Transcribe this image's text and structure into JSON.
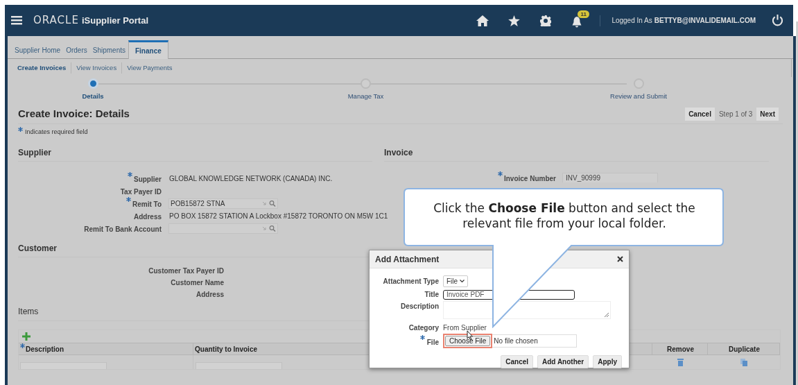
{
  "header": {
    "logo": "ORACLE",
    "app_title": "iSupplier Portal",
    "notification_count": "11",
    "logged_in_label": "Logged In As",
    "user": "BETTYB@INVALIDEMAIL.COM"
  },
  "tabs": [
    {
      "label": "Supplier Home",
      "selected": false
    },
    {
      "label": "Orders",
      "selected": false
    },
    {
      "label": "Shipments",
      "selected": false
    },
    {
      "label": "Finance",
      "selected": true
    }
  ],
  "subtabs": [
    {
      "label": "Create Invoices",
      "selected": true
    },
    {
      "label": "View Invoices",
      "selected": false
    },
    {
      "label": "View Payments",
      "selected": false
    }
  ],
  "train": [
    {
      "label": "Details",
      "selected": true
    },
    {
      "label": "Manage Tax",
      "selected": false
    },
    {
      "label": "Review and Submit",
      "selected": false
    }
  ],
  "page_title": "Create Invoice: Details",
  "actions": {
    "cancel": "Cancel",
    "step": "Step 1 of 3",
    "next": "Next"
  },
  "required_note": "Indicates required field",
  "supplier": {
    "heading": "Supplier",
    "fields": [
      {
        "label": "Supplier",
        "kind": "text",
        "value": "GLOBAL KNOWLEDGE NETWORK (CANADA) INC.",
        "required": true
      },
      {
        "label": "Tax Payer ID",
        "kind": "text",
        "required": false
      },
      {
        "label": "Remit To",
        "kind": "lov",
        "value": "POB15872 STNA",
        "required": true
      },
      {
        "label": "Address",
        "kind": "text",
        "value": "PO BOX 15872 STATION A Lockbox #15872 TORONTO ON M5W 1C1",
        "required": false
      },
      {
        "label": "Remit To Bank Account",
        "kind": "lov",
        "required": false
      }
    ]
  },
  "invoice": {
    "heading": "Invoice",
    "fields": [
      {
        "label": "Invoice Number",
        "value": "INV_90999",
        "required": true
      }
    ]
  },
  "customer": {
    "heading": "Customer",
    "fields": [
      {
        "label": "Customer Tax Payer ID"
      },
      {
        "label": "Customer Name"
      },
      {
        "label": "Address"
      }
    ]
  },
  "items": {
    "heading": "Items",
    "columns": [
      {
        "label": "Description",
        "required": true
      },
      {
        "label": "Quantity to Invoice",
        "required": false
      },
      {
        "label": "Remove",
        "required": false
      },
      {
        "label": "Duplicate",
        "required": false
      }
    ]
  },
  "dialog": {
    "title": "Add Attachment",
    "attachment_type": {
      "label": "Attachment Type",
      "value": "File"
    },
    "title_field": {
      "label": "Title",
      "value": "Invoice PDF"
    },
    "description": {
      "label": "Description"
    },
    "category": {
      "label": "Category",
      "value": "From Supplier"
    },
    "file": {
      "label": "File",
      "required": true,
      "button": "Choose File",
      "status": "No file chosen"
    },
    "buttons": [
      "Cancel",
      "Add Another",
      "Apply"
    ]
  },
  "callout": "Click the **Choose File** button and select the relevant file from your local folder."
}
